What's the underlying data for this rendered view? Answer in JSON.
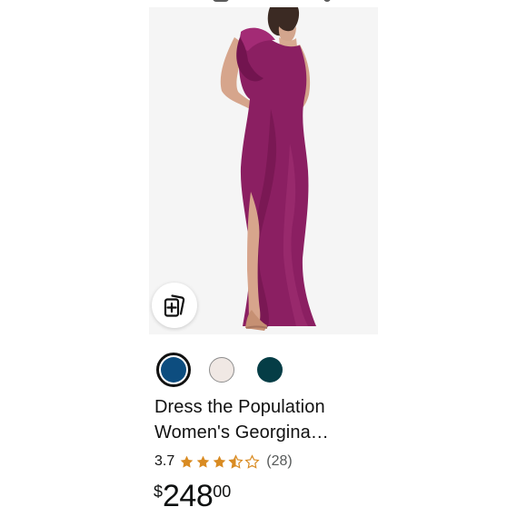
{
  "product": {
    "image_alt": "One-shoulder long magenta dress with front slit",
    "compare_icon": "cards-compare-icon",
    "swatches": [
      {
        "color": "#0d4d7f",
        "selected": true
      },
      {
        "color": "#f0e8e4",
        "selected": false
      },
      {
        "color": "#053d46",
        "selected": false
      }
    ],
    "title_line_1": "Dress the Population",
    "title_line_2": "Women's Georgina…",
    "rating": {
      "value": "3.7",
      "stars": 3.7,
      "count_label": "(28)"
    },
    "price": {
      "symbol": "$",
      "whole": "248",
      "fraction": "00"
    }
  },
  "colors": {
    "dress": "#8b1f62",
    "star": "#d98b22",
    "text": "#111111",
    "muted": "#565959"
  }
}
